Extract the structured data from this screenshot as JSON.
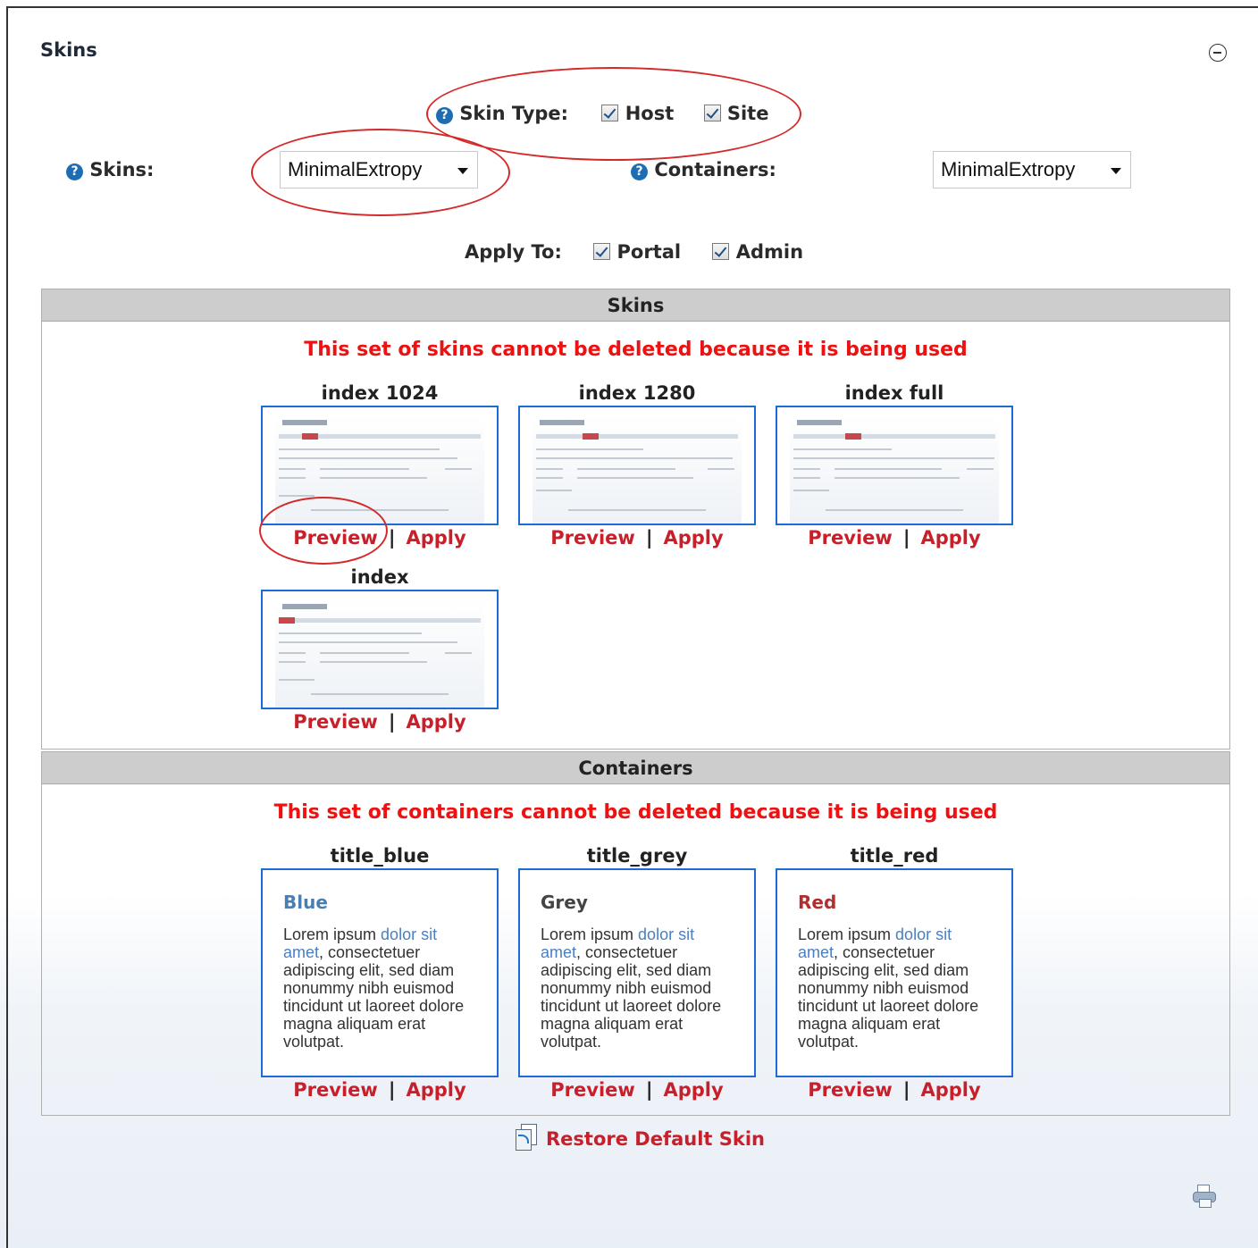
{
  "module": {
    "title": "Skins"
  },
  "skin_type": {
    "label": "Skin Type:",
    "options": [
      {
        "label": "Host",
        "checked": true
      },
      {
        "label": "Site",
        "checked": true
      }
    ]
  },
  "skins_select": {
    "label": "Skins:",
    "value": "MinimalExtropy"
  },
  "containers_select": {
    "label": "Containers:",
    "value": "MinimalExtropy"
  },
  "apply_to": {
    "label": "Apply To:",
    "options": [
      {
        "label": "Portal",
        "checked": true
      },
      {
        "label": "Admin",
        "checked": true
      }
    ]
  },
  "skins_section": {
    "header": "Skins",
    "warning": "This set of skins cannot be deleted because it is being used",
    "items": [
      {
        "name": "index 1024",
        "preview": "Preview",
        "separator": "|",
        "apply": "Apply"
      },
      {
        "name": "index 1280",
        "preview": "Preview",
        "separator": "|",
        "apply": "Apply"
      },
      {
        "name": "index full",
        "preview": "Preview",
        "separator": "|",
        "apply": "Apply"
      },
      {
        "name": "index",
        "preview": "Preview",
        "separator": "|",
        "apply": "Apply"
      }
    ]
  },
  "containers_section": {
    "header": "Containers",
    "warning": "This set of containers cannot be deleted because it is being used",
    "items": [
      {
        "name": "title_blue",
        "heading": "Blue",
        "heading_color": "#4a7fb0",
        "text_start": "Lorem ipsum ",
        "text_link": "dolor sit amet",
        "text_rest": ", consectetuer adipiscing elit, sed diam nonummy nibh euismod tincidunt ut laoreet dolore magna aliquam erat volutpat.",
        "preview": "Preview",
        "separator": "|",
        "apply": "Apply"
      },
      {
        "name": "title_grey",
        "heading": "Grey",
        "heading_color": "#444444",
        "text_start": "Lorem ipsum ",
        "text_link": "dolor sit amet",
        "text_rest": ", consectetuer adipiscing elit, sed diam nonummy nibh euismod tincidunt ut laoreet dolore magna aliquam erat volutpat.",
        "preview": "Preview",
        "separator": "|",
        "apply": "Apply"
      },
      {
        "name": "title_red",
        "heading": "Red",
        "heading_color": "#b03030",
        "text_start": "Lorem ipsum ",
        "text_link": "dolor sit amet",
        "text_rest": ", consectetuer adipiscing elit, sed diam nonummy nibh euismod tincidunt ut laoreet dolore magna aliquam erat volutpat.",
        "preview": "Preview",
        "separator": "|",
        "apply": "Apply"
      }
    ]
  },
  "restore": {
    "label": "Restore Default Skin"
  },
  "colors": {
    "link_red": "#c8202b",
    "warning_red": "#ee1111",
    "accent_blue": "#1d6cd6",
    "annotation_red": "#d42a2a"
  }
}
